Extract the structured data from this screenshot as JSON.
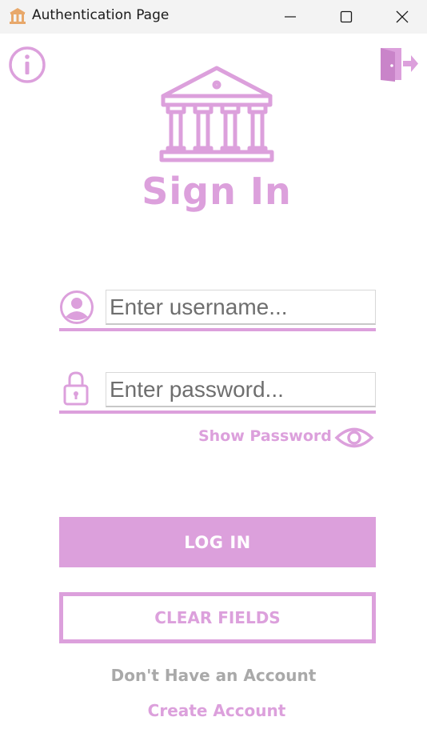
{
  "window": {
    "title": "Authentication Page",
    "controls": [
      "minimize-icon",
      "maximize-icon",
      "close-icon"
    ]
  },
  "header": {
    "left_icon": "info-icon",
    "right_icon": "exit-door-icon",
    "logo_icon": "bank-building-icon",
    "heading": "Sign In"
  },
  "form": {
    "username": {
      "icon": "user-icon",
      "placeholder": "Enter username...",
      "value": ""
    },
    "password": {
      "icon": "lock-icon",
      "placeholder": "Enter password...",
      "value": ""
    },
    "show_password_label": "Show Password",
    "show_password_icon": "eye-icon"
  },
  "actions": {
    "login_label": "LOG IN",
    "clear_label": "CLEAR FIELDS"
  },
  "footer": {
    "no_account_text": "Don't Have an Account",
    "create_account_label": "Create Account"
  },
  "colors": {
    "accent": "#dca0dc",
    "muted_text": "#a9a9a9",
    "titlebar": "#f3f3f3",
    "app_icon": "#e8a86a"
  }
}
